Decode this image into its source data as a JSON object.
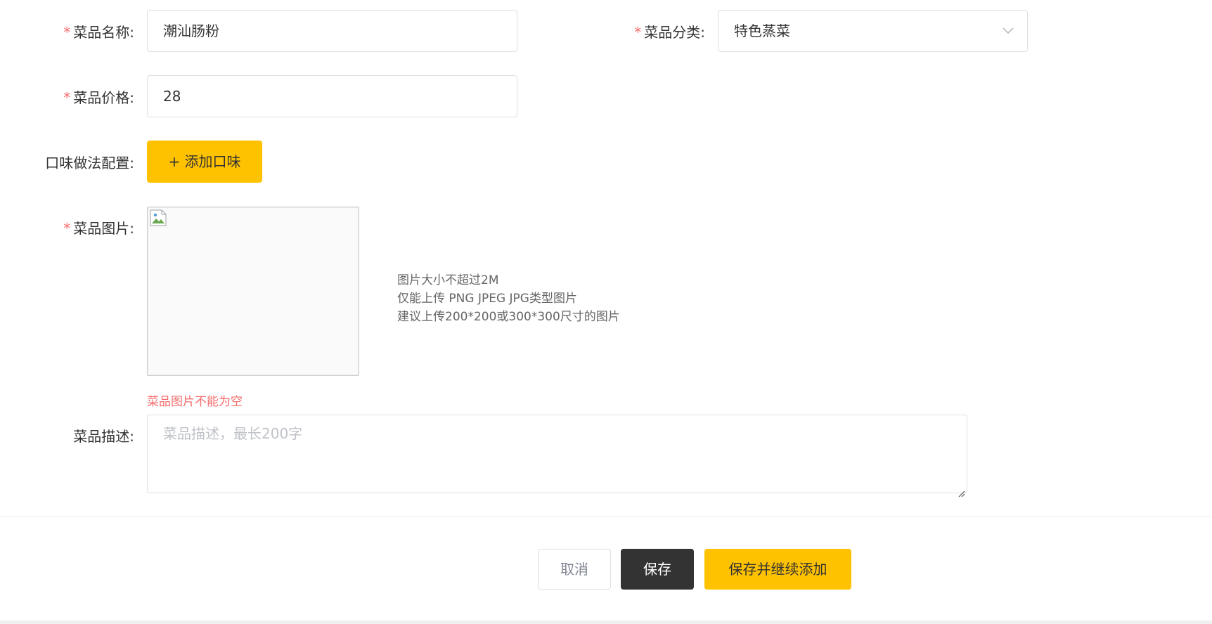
{
  "form": {
    "dish_name": {
      "required_mark": "*",
      "label": "菜品名称:",
      "value": "潮汕肠粉"
    },
    "dish_category": {
      "required_mark": "*",
      "label": "菜品分类:",
      "selected": "特色蒸菜",
      "icon": "chevron-down-icon"
    },
    "dish_price": {
      "required_mark": "*",
      "label": "菜品价格:",
      "value": "28"
    },
    "flavor_config": {
      "label": "口味做法配置:",
      "add_button_label": "+ 添加口味"
    },
    "dish_image": {
      "required_mark": "*",
      "label": "菜品图片:",
      "icon": "broken-image-icon",
      "tips": [
        "图片大小不超过2M",
        "仅能上传 PNG JPEG JPG类型图片",
        "建议上传200*200或300*300尺寸的图片"
      ],
      "error": "菜品图片不能为空"
    },
    "dish_description": {
      "label": "菜品描述:",
      "placeholder": "菜品描述，最长200字",
      "value": ""
    }
  },
  "footer": {
    "cancel_label": "取消",
    "save_label": "保存",
    "save_continue_label": "保存并继续添加"
  },
  "colors": {
    "accent": "#ffc200",
    "dark_button": "#333333",
    "error": "#f56c6c",
    "border": "#dcdfe6"
  }
}
